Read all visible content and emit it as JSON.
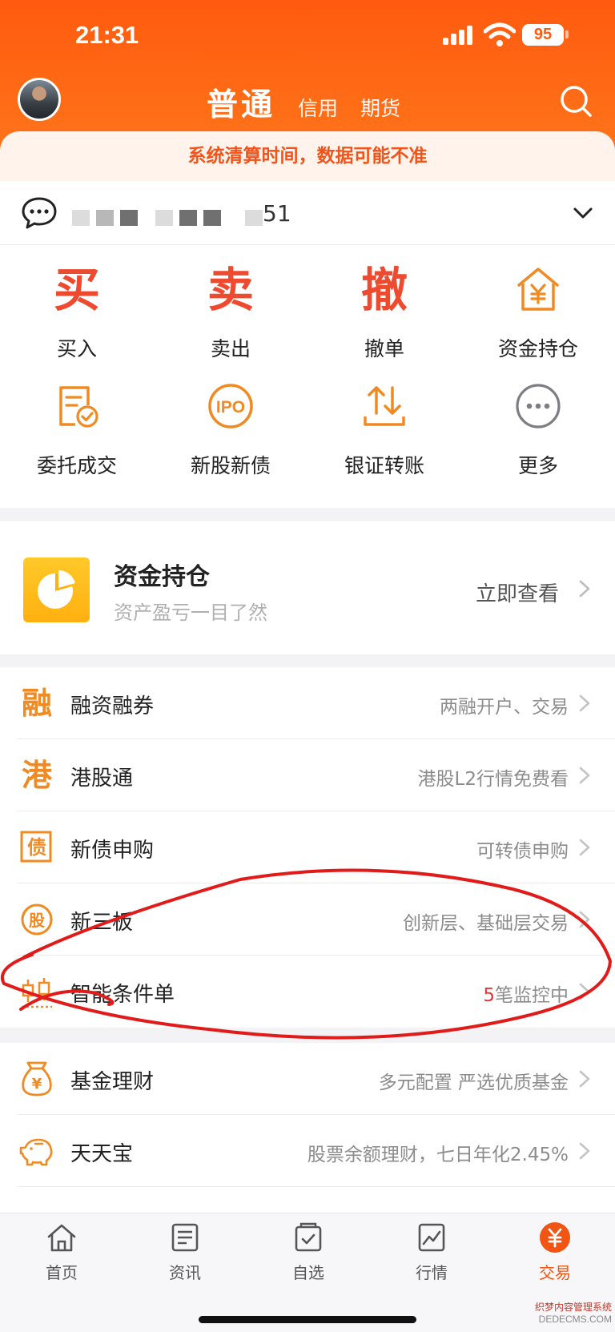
{
  "status": {
    "time": "21:31",
    "battery": "95"
  },
  "header": {
    "tabs": [
      {
        "label": "普通",
        "active": true
      },
      {
        "label": "信用",
        "active": false
      },
      {
        "label": "期货",
        "active": false
      }
    ]
  },
  "notice": "系统清算时间，数据可能不准",
  "account": {
    "id_suffix": "51"
  },
  "quick_actions": [
    {
      "label": "买入",
      "glyph": "买"
    },
    {
      "label": "卖出",
      "glyph": "卖"
    },
    {
      "label": "撤单",
      "glyph": "撤"
    },
    {
      "label": "资金持仓",
      "icon": "house-yuan-icon"
    },
    {
      "label": "委托成交",
      "icon": "order-check-icon"
    },
    {
      "label": "新股新债",
      "icon": "ipo-icon",
      "icon_text": "IPO"
    },
    {
      "label": "银证转账",
      "icon": "transfer-icon"
    },
    {
      "label": "更多",
      "icon": "more-dots-icon"
    }
  ],
  "asset_card": {
    "title": "资金持仓",
    "subtitle": "资产盈亏一目了然",
    "action": "立即查看"
  },
  "services": [
    {
      "glyph": "融",
      "title": "融资融券",
      "desc": "两融开户、交易"
    },
    {
      "glyph": "港",
      "title": "港股通",
      "desc": "港股L2行情免费看"
    },
    {
      "glyph": "债",
      "title": "新债申购",
      "desc": "可转债申购"
    },
    {
      "glyph": "股",
      "title": "新三板",
      "desc": "创新层、基础层交易"
    },
    {
      "title": "智能条件单",
      "desc_num": "5",
      "desc": "笔监控中"
    }
  ],
  "services2": [
    {
      "glyph": "¥",
      "title": "基金理财",
      "desc": "多元配置 严选优质基金"
    },
    {
      "title": "天天宝",
      "desc": "股票余额理财，七日年化2.45%"
    }
  ],
  "tabbar": [
    {
      "label": "首页",
      "icon": "home-icon"
    },
    {
      "label": "资讯",
      "icon": "news-icon"
    },
    {
      "label": "自选",
      "icon": "watchlist-icon"
    },
    {
      "label": "行情",
      "icon": "market-icon"
    },
    {
      "label": "交易",
      "icon": "trade-yuan-icon",
      "active": true
    }
  ],
  "watermark": {
    "line1": "织梦内容管理系统",
    "line2": "DEDECMS.COM"
  },
  "colors": {
    "brand": "#ff5a0f",
    "accent_orange": "#f08a22",
    "red_glyph": "#ee4a30",
    "annotation": "#e11a1a"
  }
}
